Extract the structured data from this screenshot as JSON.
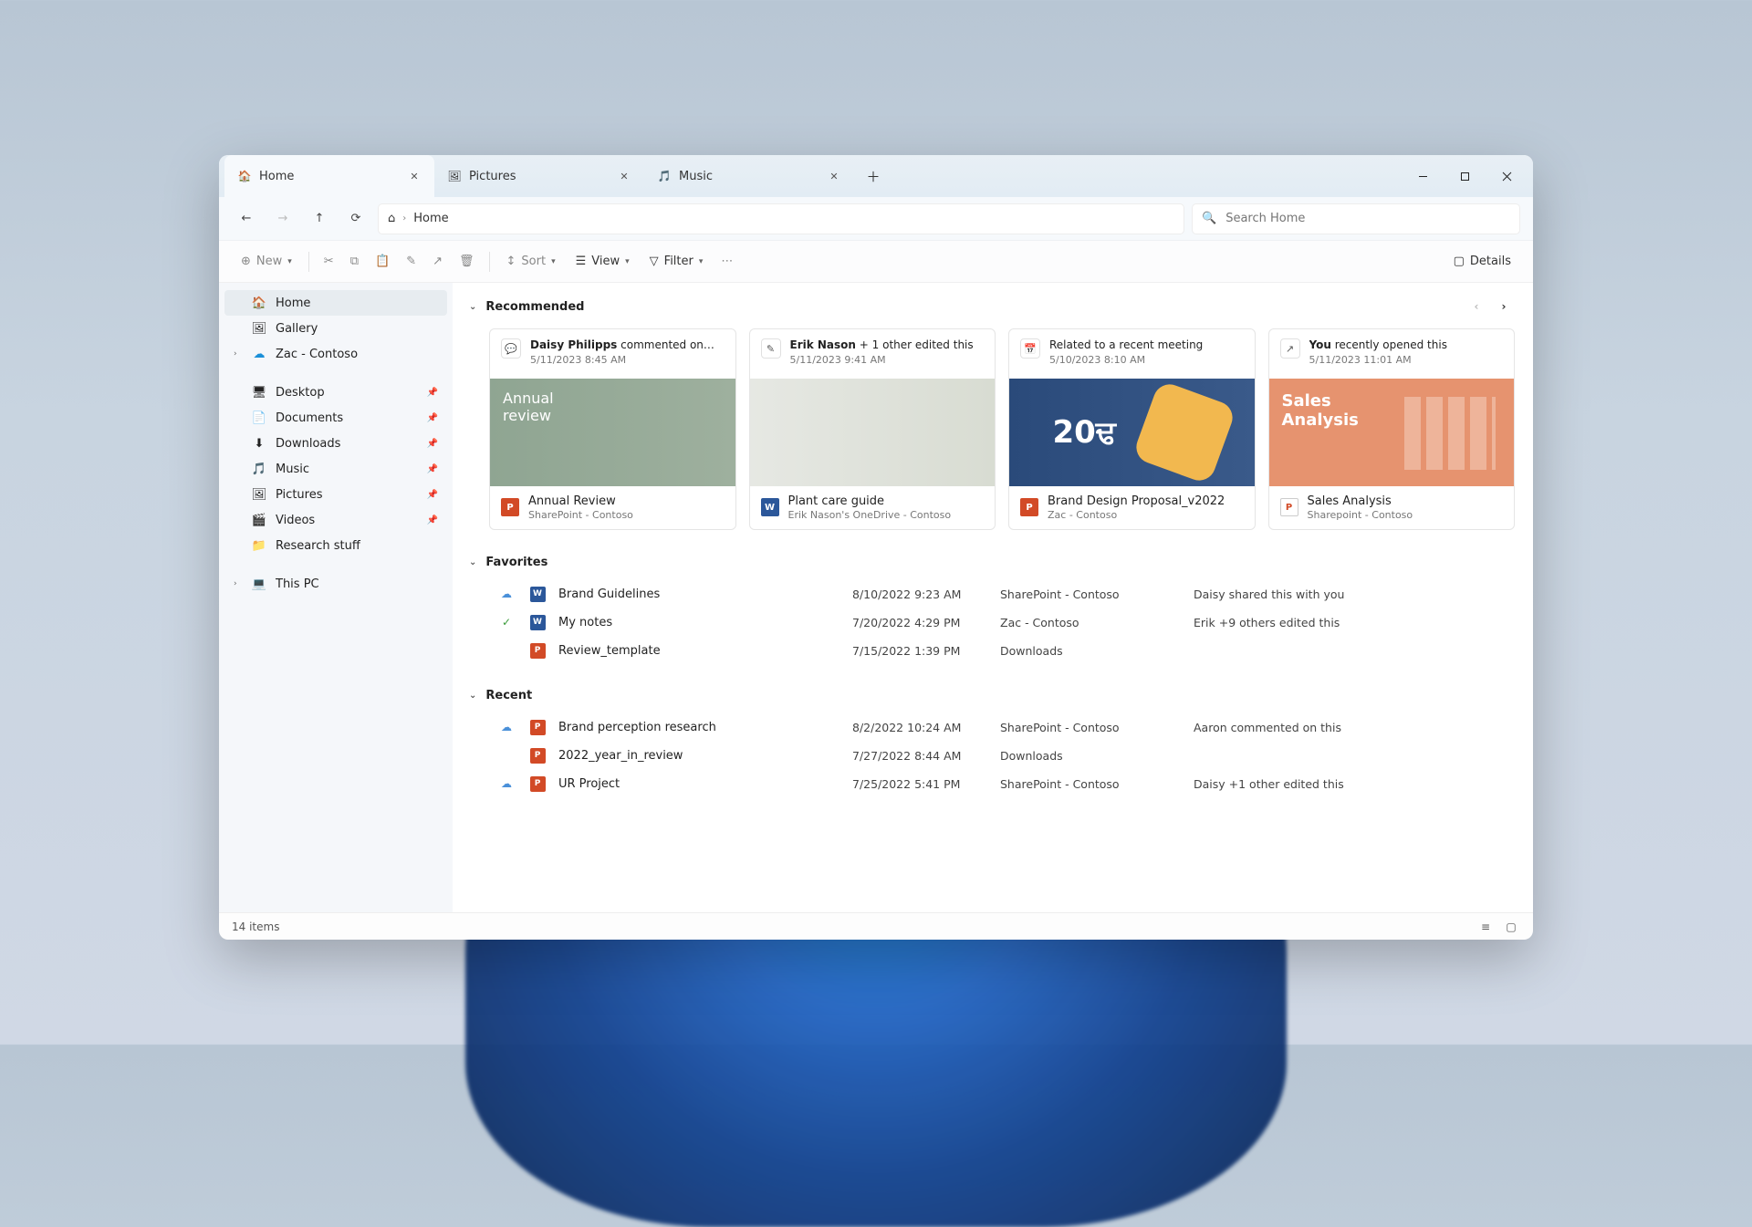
{
  "tabs": [
    {
      "label": "Home",
      "icon": "🏠"
    },
    {
      "label": "Pictures",
      "icon": "🖼"
    },
    {
      "label": "Music",
      "icon": "🎵"
    }
  ],
  "breadcrumb": "Home",
  "search_placeholder": "Search Home",
  "toolbar": {
    "new": "New",
    "sort": "Sort",
    "view": "View",
    "filter": "Filter",
    "details": "Details"
  },
  "sidebar": {
    "top": [
      {
        "label": "Home",
        "icon": "🏠"
      },
      {
        "label": "Gallery",
        "icon": "🖼"
      },
      {
        "label": "Zac - Contoso",
        "icon": "☁",
        "expandable": true
      }
    ],
    "pinned": [
      {
        "label": "Desktop",
        "icon": "🖥"
      },
      {
        "label": "Documents",
        "icon": "📄"
      },
      {
        "label": "Downloads",
        "icon": "⬇"
      },
      {
        "label": "Music",
        "icon": "🎵"
      },
      {
        "label": "Pictures",
        "icon": "🖼"
      },
      {
        "label": "Videos",
        "icon": "🎬"
      },
      {
        "label": "Research stuff",
        "icon": "📁"
      }
    ],
    "thispc": {
      "label": "This PC",
      "icon": "💻"
    }
  },
  "sections": {
    "recommended": "Recommended",
    "favorites": "Favorites",
    "recent": "Recent"
  },
  "cards": [
    {
      "actorBold": "Daisy Philipps",
      "actorRest": " commented on…",
      "time": "5/11/2023 8:45 AM",
      "actIcon": "💬",
      "thumb": "annual",
      "fileType": "ppt",
      "title": "Annual Review",
      "sub": "SharePoint - Contoso"
    },
    {
      "actorBold": "Erik Nason",
      "actorRest": " + 1 other edited this",
      "time": "5/11/2023 9:41 AM",
      "actIcon": "✎",
      "thumb": "plant",
      "fileType": "word",
      "title": "Plant care guide",
      "sub": "Erik Nason's OneDrive - Contoso"
    },
    {
      "actorBold": "",
      "actorRest": "Related to a recent meeting",
      "time": "5/10/2023 8:10 AM",
      "actIcon": "📅",
      "thumb": "brand",
      "fileType": "ppt",
      "title": "Brand Design Proposal_v2022",
      "sub": "Zac - Contoso"
    },
    {
      "actorBold": "You",
      "actorRest": " recently opened this",
      "time": "5/11/2023 11:01 AM",
      "actIcon": "↗",
      "thumb": "sales",
      "fileType": "pdf",
      "title": "Sales Analysis",
      "sub": "Sharepoint - Contoso"
    }
  ],
  "favorites": [
    {
      "status": "cloud",
      "type": "word",
      "name": "Brand Guidelines",
      "date": "8/10/2022 9:23 AM",
      "loc": "SharePoint - Contoso",
      "det": "Daisy shared this with you"
    },
    {
      "status": "check",
      "type": "word",
      "name": "My notes",
      "date": "7/20/2022 4:29 PM",
      "loc": "Zac - Contoso",
      "det": "Erik +9 others edited this"
    },
    {
      "status": "",
      "type": "ppt",
      "name": "Review_template",
      "date": "7/15/2022 1:39 PM",
      "loc": "Downloads",
      "det": ""
    }
  ],
  "recent": [
    {
      "status": "cloud",
      "type": "ppt",
      "name": "Brand perception research",
      "date": "8/2/2022 10:24 AM",
      "loc": "SharePoint - Contoso",
      "det": "Aaron commented on this"
    },
    {
      "status": "",
      "type": "ppt",
      "name": "2022_year_in_review",
      "date": "7/27/2022 8:44 AM",
      "loc": "Downloads",
      "det": ""
    },
    {
      "status": "cloud",
      "type": "ppt",
      "name": "UR Project",
      "date": "7/25/2022 5:41 PM",
      "loc": "SharePoint - Contoso",
      "det": "Daisy +1 other edited this"
    }
  ],
  "status_text": "14 items"
}
